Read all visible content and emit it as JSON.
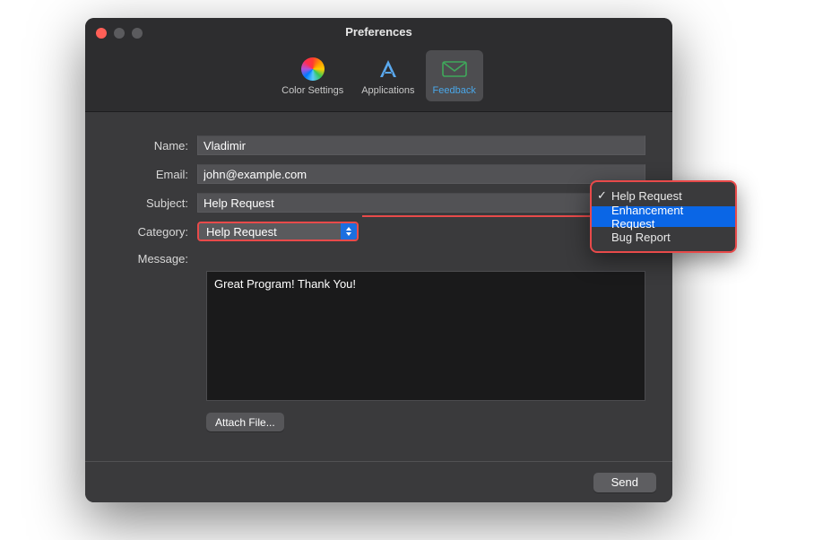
{
  "window": {
    "title": "Preferences"
  },
  "tabs": [
    {
      "label": "Color Settings"
    },
    {
      "label": "Applications"
    },
    {
      "label": "Feedback"
    }
  ],
  "labels": {
    "name": "Name:",
    "email": "Email:",
    "subject": "Subject:",
    "category": "Category:",
    "message": "Message:"
  },
  "fields": {
    "name": "Vladimir",
    "email": "john@example.com",
    "subject": "Help Request",
    "category": "Help Request",
    "message": "Great Program! Thank You!"
  },
  "buttons": {
    "attach": "Attach File...",
    "send": "Send"
  },
  "category_options": [
    {
      "label": "Help Request",
      "checked": true,
      "highlight": false
    },
    {
      "label": "Enhancement Request",
      "checked": false,
      "highlight": true
    },
    {
      "label": "Bug Report",
      "checked": false,
      "highlight": false
    }
  ]
}
